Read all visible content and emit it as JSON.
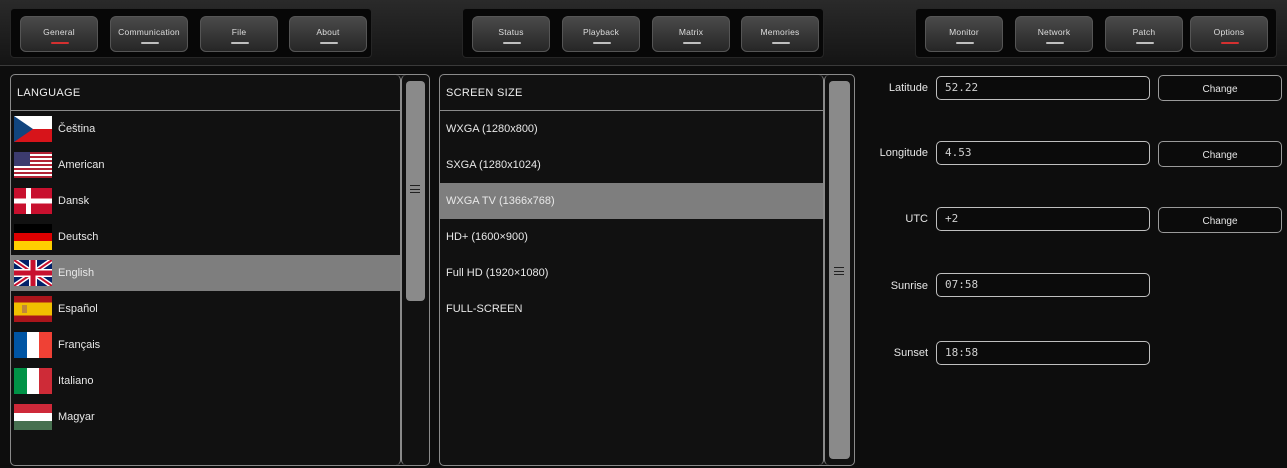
{
  "nav": {
    "group1": [
      {
        "label": "General",
        "active": true
      },
      {
        "label": "Communication",
        "active": false
      },
      {
        "label": "File",
        "active": false
      },
      {
        "label": "About",
        "active": false
      }
    ],
    "group2": [
      {
        "label": "Status",
        "active": false
      },
      {
        "label": "Playback",
        "active": false
      },
      {
        "label": "Matrix",
        "active": false
      },
      {
        "label": "Memories",
        "active": false
      }
    ],
    "group3": [
      {
        "label": "Monitor",
        "active": false
      },
      {
        "label": "Network",
        "active": false
      },
      {
        "label": "Patch",
        "active": false
      },
      {
        "label": "Options",
        "active": true
      }
    ]
  },
  "language": {
    "header": "LANGUAGE",
    "items": [
      {
        "label": "Čeština",
        "flag": "czech-flag-icon"
      },
      {
        "label": "American",
        "flag": "usa-flag-icon"
      },
      {
        "label": "Dansk",
        "flag": "denmark-flag-icon"
      },
      {
        "label": "Deutsch",
        "flag": "germany-flag-icon"
      },
      {
        "label": "English",
        "flag": "uk-flag-icon",
        "selected": true
      },
      {
        "label": "Español",
        "flag": "spain-flag-icon"
      },
      {
        "label": "Français",
        "flag": "france-flag-icon"
      },
      {
        "label": "Italiano",
        "flag": "italy-flag-icon"
      },
      {
        "label": "Magyar",
        "flag": "hungary-flag-icon"
      }
    ]
  },
  "screen": {
    "header": "SCREEN SIZE",
    "items": [
      {
        "label": "WXGA (1280x800)"
      },
      {
        "label": "SXGA (1280x1024)"
      },
      {
        "label": "WXGA TV (1366x768)",
        "selected": true
      },
      {
        "label": "HD+ (1600×900)"
      },
      {
        "label": "Full HD (1920×1080)"
      },
      {
        "label": "FULL-SCREEN"
      }
    ]
  },
  "location": {
    "latitude_label": "Latitude",
    "latitude_value": "52.22",
    "longitude_label": "Longitude",
    "longitude_value": "4.53",
    "utc_label": "UTC",
    "utc_value": "+2",
    "sunrise_label": "Sunrise",
    "sunrise_value": "07:58",
    "sunset_label": "Sunset",
    "sunset_value": "18:58",
    "change_label": "Change"
  },
  "colors": {
    "active_indicator": "#d43030",
    "selected_row": "#7e7e7e"
  }
}
